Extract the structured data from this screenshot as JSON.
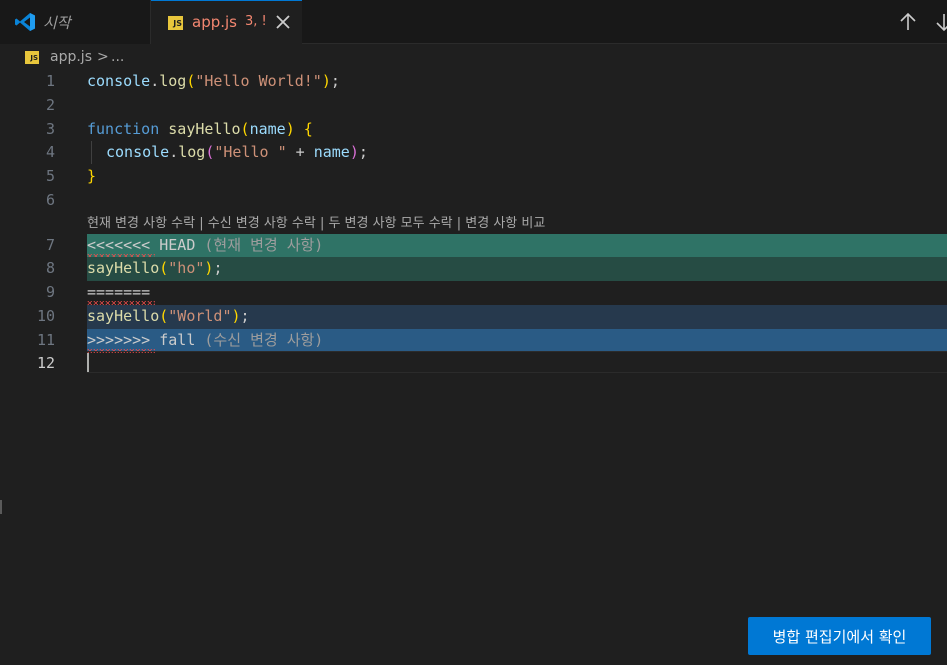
{
  "tabs": [
    {
      "label": "시작",
      "icon": "vscode-logo-icon",
      "active": false
    },
    {
      "label": "app.js",
      "icon": "js-file-icon",
      "badge": "3, !",
      "active": true
    }
  ],
  "tab_actions": {
    "prev_icon": "arrow-up-icon",
    "next_icon": "arrow-down-icon"
  },
  "breadcrumb": {
    "file": "app.js",
    "separator": ">",
    "more": "..."
  },
  "file_badge": "JS",
  "lines": [
    {
      "num": "1"
    },
    {
      "num": "2"
    },
    {
      "num": "3"
    },
    {
      "num": "4"
    },
    {
      "num": "5"
    },
    {
      "num": "6"
    },
    {
      "num": "7"
    },
    {
      "num": "8"
    },
    {
      "num": "9"
    },
    {
      "num": "10"
    },
    {
      "num": "11"
    },
    {
      "num": "12"
    }
  ],
  "code": {
    "l1": {
      "obj": "console",
      "dot": ".",
      "fn": "log",
      "open": "(",
      "str": "\"Hello World!\"",
      "close": ")",
      "end": ";"
    },
    "l3": {
      "kw": "function",
      "fn": "sayHello",
      "open": "(",
      "param": "name",
      "close": ")",
      "brace": "{"
    },
    "l4": {
      "obj": "console",
      "dot": ".",
      "fn": "log",
      "open": "(",
      "str": "\"Hello \"",
      "op": " + ",
      "var": "name",
      "close": ")",
      "end": ";"
    },
    "l5": {
      "brace": "}"
    },
    "l7": {
      "marker": "<<<<<<< HEAD",
      "note": "(현재 변경 사항)"
    },
    "l8": {
      "fn": "sayHello",
      "open": "(",
      "str": "\"ho\"",
      "close": ")",
      "end": ";"
    },
    "l9": {
      "marker": "======="
    },
    "l10": {
      "fn": "sayHello",
      "open": "(",
      "str": "\"World\"",
      "close": ")",
      "end": ";"
    },
    "l11": {
      "marker": ">>>>>>> fall",
      "note": "(수신 변경 사항)"
    }
  },
  "codelens": {
    "accept_current": "현재 변경 사항 수락",
    "accept_incoming": "수신 변경 사항 수락",
    "accept_both": "두 변경 사항 모두 수락",
    "compare": "변경 사항 비교",
    "separator": " | "
  },
  "merge_button": {
    "label": "병합 편집기에서 확인"
  },
  "colors": {
    "accent": "#0078d4",
    "current_header": "#2f7366",
    "current_body": "#264c44",
    "incoming_body": "#26394d",
    "incoming_header": "#2a5b85",
    "error": "#f14c4c"
  }
}
